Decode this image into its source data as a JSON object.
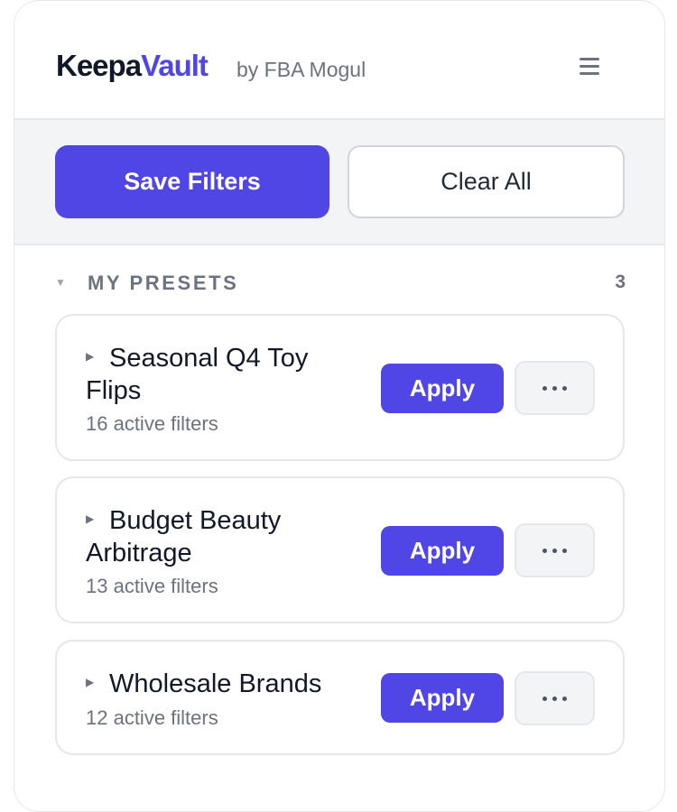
{
  "header": {
    "logo_primary": "Keepa",
    "logo_accent": "Vault",
    "byline": "by FBA Mogul",
    "menu_icon": "hamburger-menu-icon"
  },
  "toolbar": {
    "save_label": "Save Filters",
    "clear_label": "Clear All"
  },
  "presets_section": {
    "title": "MY PRESETS",
    "count": "3",
    "collapse_icon": "caret-down-icon"
  },
  "presets": [
    {
      "title": "Seasonal Q4 Toy Flips",
      "subtitle": "16 active filters",
      "apply_label": "Apply"
    },
    {
      "title": "Budget Beauty Arbitrage",
      "subtitle": "13 active filters",
      "apply_label": "Apply"
    },
    {
      "title": "Wholesale Brands",
      "subtitle": "12 active filters",
      "apply_label": "Apply"
    }
  ],
  "colors": {
    "accent": "#4f46e5",
    "text_primary": "#111827",
    "text_muted": "#6b7280",
    "toolbar_bg": "#f3f4f6",
    "border": "#e5e7eb"
  }
}
